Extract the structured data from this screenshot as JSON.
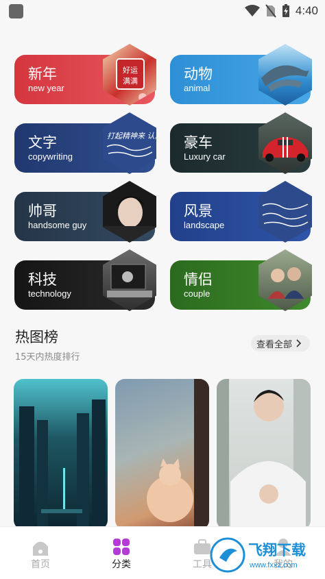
{
  "status_bar": {
    "time": "4:40"
  },
  "categories": [
    {
      "cn": "新年",
      "en": "new year",
      "color_from": "#d4363e",
      "color_to": "#e8575e"
    },
    {
      "cn": "动物",
      "en": "animal",
      "color_from": "#2e8fd6",
      "color_to": "#46a6e6"
    },
    {
      "cn": "文字",
      "en": "copywriting",
      "color_from": "#21386f",
      "color_to": "#2f4f90"
    },
    {
      "cn": "豪车",
      "en": "Luxury car",
      "color_from": "#1b2a2c",
      "color_to": "#2b3d3f"
    },
    {
      "cn": "帅哥",
      "en": "handsome guy",
      "color_from": "#253548",
      "color_to": "#334a61"
    },
    {
      "cn": "风景",
      "en": "landscape",
      "color_from": "#22408a",
      "color_to": "#2e55a8"
    },
    {
      "cn": "科技",
      "en": "technology",
      "color_from": "#151515",
      "color_to": "#2a2a2a"
    },
    {
      "cn": "情侣",
      "en": "couple",
      "color_from": "#2b6a1e",
      "color_to": "#3e8a2c"
    }
  ],
  "hex_overlays": {
    "new_year_text_1": "好运",
    "new_year_text_2": "满满",
    "copy_text": "打起精神来 认真学"
  },
  "hot_section": {
    "title": "热图榜",
    "subtitle": "15天内热度排行",
    "see_all": "查看全部"
  },
  "tabs": [
    {
      "label": "首页",
      "icon": "home-icon"
    },
    {
      "label": "分类",
      "icon": "grid-icon"
    },
    {
      "label": "工具",
      "icon": "toolbox-icon"
    },
    {
      "label": "我的",
      "icon": "profile-icon"
    }
  ],
  "watermark": {
    "brand": "飞翔下载",
    "url": "www.fxxz.com"
  }
}
